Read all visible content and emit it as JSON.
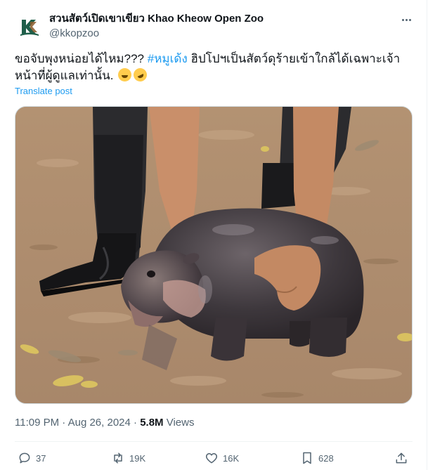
{
  "author": {
    "display_name": "สวนสัตว์เปิดเขาเขียว Khao Kheow Open Zoo",
    "handle": "@kkopzoo",
    "avatar_icon": "kk-logo-icon"
  },
  "post": {
    "text_before": "ขอจับพุงหน่อยได้ไหม??? ",
    "hashtag": "#หมูเด้ง",
    "text_after": " ฮิปโปฯเป็นสัตว์ดุร้ายเข้าใกล้ได้เฉพาะเจ้าหน้าที่ผู้ดูแลเท่านั้น. ",
    "emojis": [
      "grinning-squinting-face",
      "rolling-on-floor-laughing"
    ],
    "translate_label": "Translate post"
  },
  "meta": {
    "time": "11:09 PM",
    "separator": "·",
    "date": "Aug 26, 2024",
    "views_count": "5.8M",
    "views_label": "Views"
  },
  "actions": {
    "replies": "37",
    "reposts": "19K",
    "likes": "16K",
    "bookmarks": "628"
  },
  "colors": {
    "accent": "#1d9bf0",
    "text": "#0f1419",
    "secondary": "#536471",
    "border": "#cfd9de"
  }
}
